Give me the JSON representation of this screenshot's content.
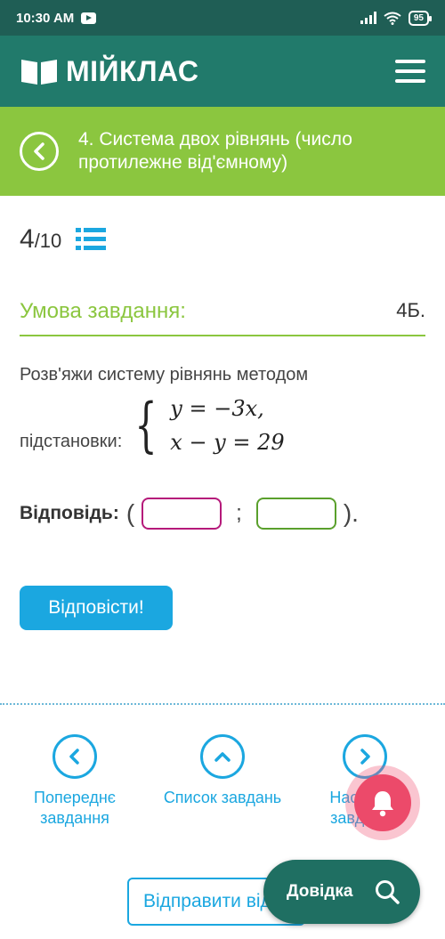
{
  "status_bar": {
    "time": "10:30 AM",
    "battery": "95"
  },
  "header": {
    "logo_text": "МІЙКЛАС",
    "logo_icon": "book-icon",
    "menu_icon": "hamburger-menu-icon"
  },
  "topic": {
    "back_icon": "chevron-left-icon",
    "title": "4. Система двох рівнянь (число протилежне від'ємному)"
  },
  "progress": {
    "current": "4",
    "total": "/10",
    "list_icon": "list-icon"
  },
  "task": {
    "heading": "Умова завдання:",
    "points": "4Б.",
    "text_line1": "Розв'яжи систему рівнянь методом",
    "text_line2": "підстановки:",
    "equation1": "y = −3x,",
    "equation2": "x − y = 29"
  },
  "answer": {
    "label": "Відповідь:",
    "open_paren": "(",
    "separator": ";",
    "close_paren": ").",
    "value1": "",
    "value2": ""
  },
  "submit_button": "Відповісти!",
  "nav": {
    "prev_label": "Попереднє завдання",
    "list_label": "Список завдань",
    "next_label": "Наступне завдання"
  },
  "send_button": "Відправити відповідь",
  "help_button": "Довідка",
  "colors": {
    "header": "#217a6b",
    "topic": "#8bc63f",
    "accent": "#1ba7e0",
    "bell": "#ec4a6a"
  }
}
